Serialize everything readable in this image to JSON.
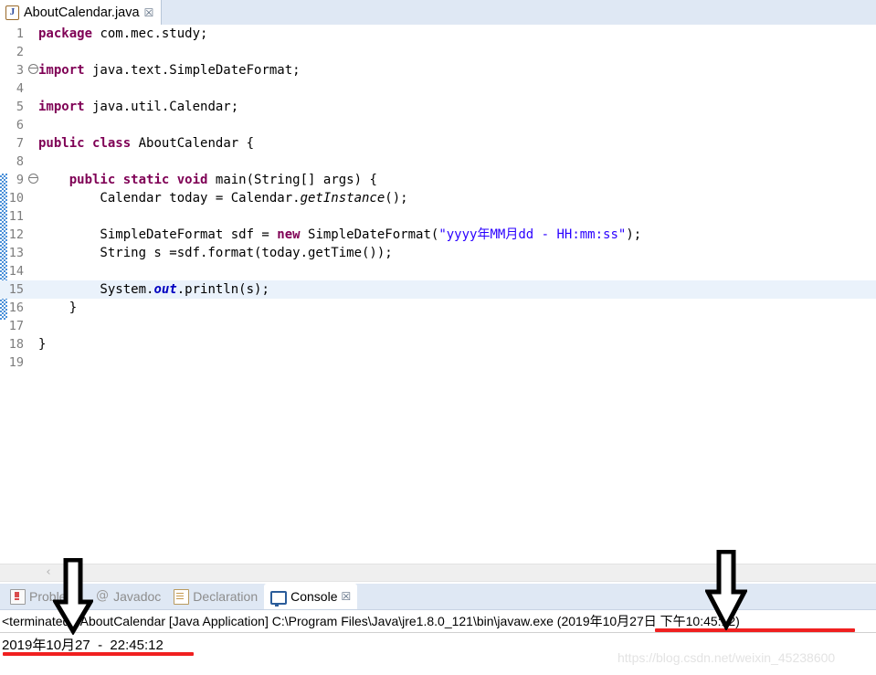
{
  "editor": {
    "tab": {
      "icon": "java-file-icon",
      "label": "AboutCalendar.java",
      "close_glyph": "☒"
    },
    "highlighted_line": 15,
    "change_bar_lines": "9-16",
    "lines": [
      {
        "n": "1",
        "fold": false,
        "tokens": [
          {
            "t": "kw",
            "v": "package"
          },
          {
            "t": "plain",
            "v": " com.mec.study;"
          }
        ]
      },
      {
        "n": "2",
        "fold": false,
        "tokens": []
      },
      {
        "n": "3",
        "fold": true,
        "tokens": [
          {
            "t": "kw",
            "v": "import"
          },
          {
            "t": "plain",
            "v": " java.text.SimpleDateFormat;"
          }
        ]
      },
      {
        "n": "4",
        "fold": false,
        "tokens": []
      },
      {
        "n": "5",
        "fold": false,
        "tokens": [
          {
            "t": "kw",
            "v": "import"
          },
          {
            "t": "plain",
            "v": " java.util.Calendar;"
          }
        ]
      },
      {
        "n": "6",
        "fold": false,
        "tokens": []
      },
      {
        "n": "7",
        "fold": false,
        "tokens": [
          {
            "t": "kw",
            "v": "public"
          },
          {
            "t": "plain",
            "v": " "
          },
          {
            "t": "kw",
            "v": "class"
          },
          {
            "t": "plain",
            "v": " AboutCalendar {"
          }
        ]
      },
      {
        "n": "8",
        "fold": false,
        "tokens": []
      },
      {
        "n": "9",
        "fold": true,
        "tokens": [
          {
            "t": "plain",
            "v": "    "
          },
          {
            "t": "kw",
            "v": "public"
          },
          {
            "t": "plain",
            "v": " "
          },
          {
            "t": "kw",
            "v": "static"
          },
          {
            "t": "plain",
            "v": " "
          },
          {
            "t": "kw",
            "v": "void"
          },
          {
            "t": "plain",
            "v": " main(String[] args) {"
          }
        ]
      },
      {
        "n": "10",
        "fold": false,
        "tokens": [
          {
            "t": "plain",
            "v": "        Calendar today = Calendar."
          },
          {
            "t": "smeth",
            "v": "getInstance"
          },
          {
            "t": "plain",
            "v": "();"
          }
        ]
      },
      {
        "n": "11",
        "fold": false,
        "tokens": []
      },
      {
        "n": "12",
        "fold": false,
        "tokens": [
          {
            "t": "plain",
            "v": "        SimpleDateFormat sdf = "
          },
          {
            "t": "kw",
            "v": "new"
          },
          {
            "t": "plain",
            "v": " SimpleDateFormat("
          },
          {
            "t": "str",
            "v": "\"yyyy年MM月dd - HH:mm:ss\""
          },
          {
            "t": "plain",
            "v": ");"
          }
        ]
      },
      {
        "n": "13",
        "fold": false,
        "tokens": [
          {
            "t": "plain",
            "v": "        String s =sdf.format(today.getTime());"
          }
        ]
      },
      {
        "n": "14",
        "fold": false,
        "tokens": []
      },
      {
        "n": "15",
        "fold": false,
        "tokens": [
          {
            "t": "plain",
            "v": "        System."
          },
          {
            "t": "sfield",
            "v": "out"
          },
          {
            "t": "plain",
            "v": ".println(s);"
          }
        ]
      },
      {
        "n": "16",
        "fold": false,
        "tokens": [
          {
            "t": "plain",
            "v": "    }"
          }
        ]
      },
      {
        "n": "17",
        "fold": false,
        "tokens": []
      },
      {
        "n": "18",
        "fold": false,
        "tokens": [
          {
            "t": "plain",
            "v": "}"
          }
        ]
      },
      {
        "n": "19",
        "fold": false,
        "tokens": []
      }
    ]
  },
  "sash": {
    "chevron_glyph": "‹"
  },
  "bottom_panel": {
    "tabs": [
      {
        "label": "Problems",
        "icon": "problems-icon",
        "active": false,
        "closeable": false
      },
      {
        "label": "Javadoc",
        "icon": "javadoc-icon",
        "active": false,
        "closeable": false
      },
      {
        "label": "Declaration",
        "icon": "declaration-icon",
        "active": false,
        "closeable": false
      },
      {
        "label": "Console",
        "icon": "console-icon",
        "active": true,
        "closeable": true
      }
    ],
    "close_glyph": "☒"
  },
  "console": {
    "status_line": "<terminated> AboutCalendar [Java Application] C:\\Program Files\\Java\\jre1.8.0_121\\bin\\javaw.exe (2019年10月27日 下午10:45:12)",
    "output_line": "2019年10月27  -  22:45:12"
  },
  "annotations": {
    "red_color": "#f02020",
    "arrow_color": "#000000",
    "arrow_left_target": "console-tab",
    "arrow_right_target": "console-timestamp"
  },
  "watermark": {
    "text": "https://blog.csdn.net/weixin_45238600"
  },
  "colors": {
    "tab_strip": "#dfe8f4",
    "editor_bg": "#ffffff",
    "line_highlight": "#eaf2fb",
    "keyword": "#7f0055",
    "string": "#2a00ff",
    "static_field": "#0000c0",
    "line_number": "#7d7d7d",
    "change_bar": "#4a90d9",
    "sash": "#efefef"
  }
}
